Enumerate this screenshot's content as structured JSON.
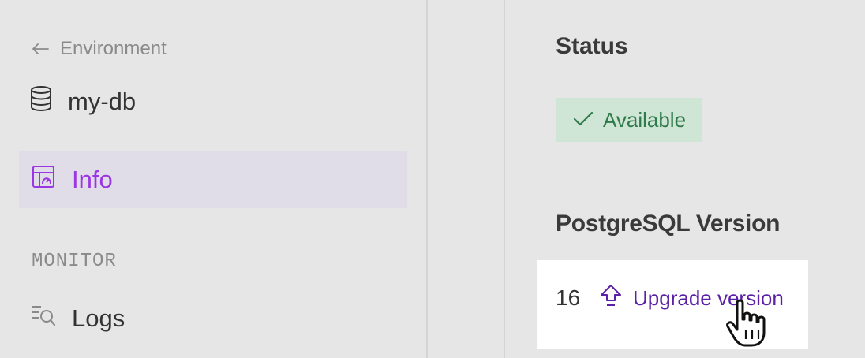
{
  "sidebar": {
    "back_label": "Environment",
    "database_name": "my-db",
    "nav_active_label": "Info",
    "section_label": "MONITOR",
    "nav_logs_label": "Logs"
  },
  "main": {
    "status_heading": "Status",
    "status_value": "Available",
    "version_heading": "PostgreSQL Version",
    "version_value": "16",
    "upgrade_label": "Upgrade version"
  },
  "icons": {
    "back": "arrow-left-icon",
    "database": "database-icon",
    "info": "dashboard-icon",
    "logs": "logs-search-icon",
    "status": "check-icon",
    "upgrade": "upgrade-arrow-icon"
  },
  "colors": {
    "accent": "#9a36e3",
    "active_bg": "#e0dce8",
    "status_bg": "#cfe5d5",
    "status_text": "#2f7a4a",
    "link": "#5a21a6"
  }
}
